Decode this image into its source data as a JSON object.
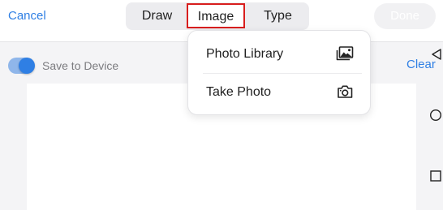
{
  "theme": {
    "accent": "#2f7fe4",
    "highlight_border": "#d81e1e"
  },
  "header": {
    "cancel_label": "Cancel",
    "tabs": [
      {
        "label": "Draw",
        "selected": false
      },
      {
        "label": "Image",
        "selected": true
      },
      {
        "label": "Type",
        "selected": false
      }
    ],
    "done_label": "Done"
  },
  "options": {
    "save_to_device_label": "Save to Device",
    "save_to_device_on": true,
    "clear_label": "Clear"
  },
  "toolbar": {
    "icons": [
      "arrow-left-icon",
      "circle-icon",
      "square-icon"
    ]
  },
  "image_menu": {
    "items": [
      {
        "label": "Photo Library",
        "icon": "photo-library-icon"
      },
      {
        "label": "Take Photo",
        "icon": "camera-icon"
      }
    ]
  }
}
